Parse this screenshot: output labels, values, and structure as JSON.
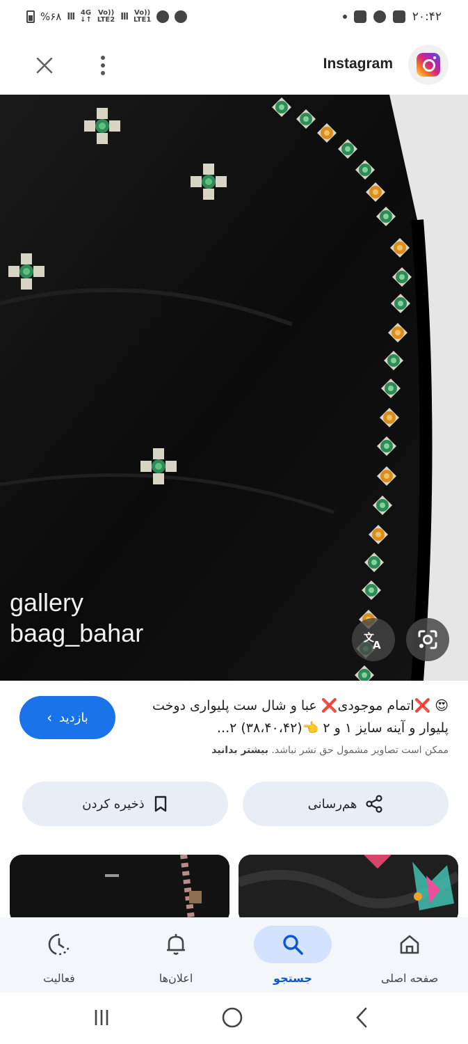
{
  "status_bar": {
    "time": "۲۰:۴۲",
    "battery": "%۶۸",
    "network1_top": "Vo))",
    "network1_bottom": "LTE1",
    "network2_top": "Vo))",
    "network2_bottom": "LTE2",
    "data_type": "4G"
  },
  "top_bar": {
    "site_title": "Instagram",
    "close_icon": "close-icon",
    "more_icon": "more-vert-icon",
    "logo_icon": "instagram-logo-icon"
  },
  "image": {
    "watermark_line1": "gallery",
    "watermark_line2": "baag_bahar",
    "translate_icon": "translate-icon",
    "lens_icon": "google-lens-icon"
  },
  "info": {
    "visit_label": "بازدید",
    "caption": "😍 ❌اتمام موجودی❌ عبا و شال ست پلیواری دوخت پلیوار و آینه سایز ۱ و ۲ 👈(۳۸،۴۰،۴۲) ۲...",
    "copyright_text": "ممکن است تصاویر مشمول حق نشر نباشد.",
    "learn_more": "بیشتر بدانید",
    "save_label": "ذخیره کردن",
    "share_label": "هم‌رسانی"
  },
  "bottom_nav": {
    "items": [
      {
        "label": "فعالیت",
        "icon": "activity-icon"
      },
      {
        "label": "اعلان‌ها",
        "icon": "bell-icon"
      },
      {
        "label": "جستجو",
        "icon": "search-icon",
        "active": true
      },
      {
        "label": "صفحه اصلی",
        "icon": "home-icon"
      }
    ]
  },
  "colors": {
    "accent": "#1a73e8",
    "pill_bg": "#e9eef6",
    "nav_active_bg": "#d3e3fd",
    "nav_active_text": "#0b57d0"
  }
}
